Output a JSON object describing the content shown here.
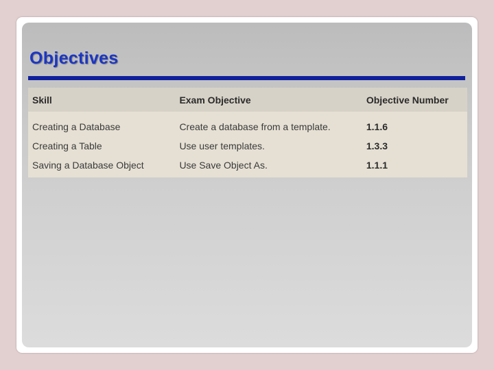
{
  "slide": {
    "title": "Objectives"
  },
  "table": {
    "headers": [
      "Skill",
      "Exam Objective",
      "Objective Number"
    ],
    "rows": [
      {
        "skill": "Creating a Database",
        "exam_objective": "Create a database from a template.",
        "objective_number": "1.1.6"
      },
      {
        "skill": "Creating a Table",
        "exam_objective": "Use user templates.",
        "objective_number": "1.3.3"
      },
      {
        "skill": "Saving a Database Object",
        "exam_objective": "Use Save Object As.",
        "objective_number": "1.1.1"
      }
    ]
  },
  "colors": {
    "background": "#e2cfcf",
    "title": "#1b36c4",
    "rule": "#0f1f9c",
    "table_header": "#d7d2c7",
    "table_body": "#e6e0d4"
  }
}
